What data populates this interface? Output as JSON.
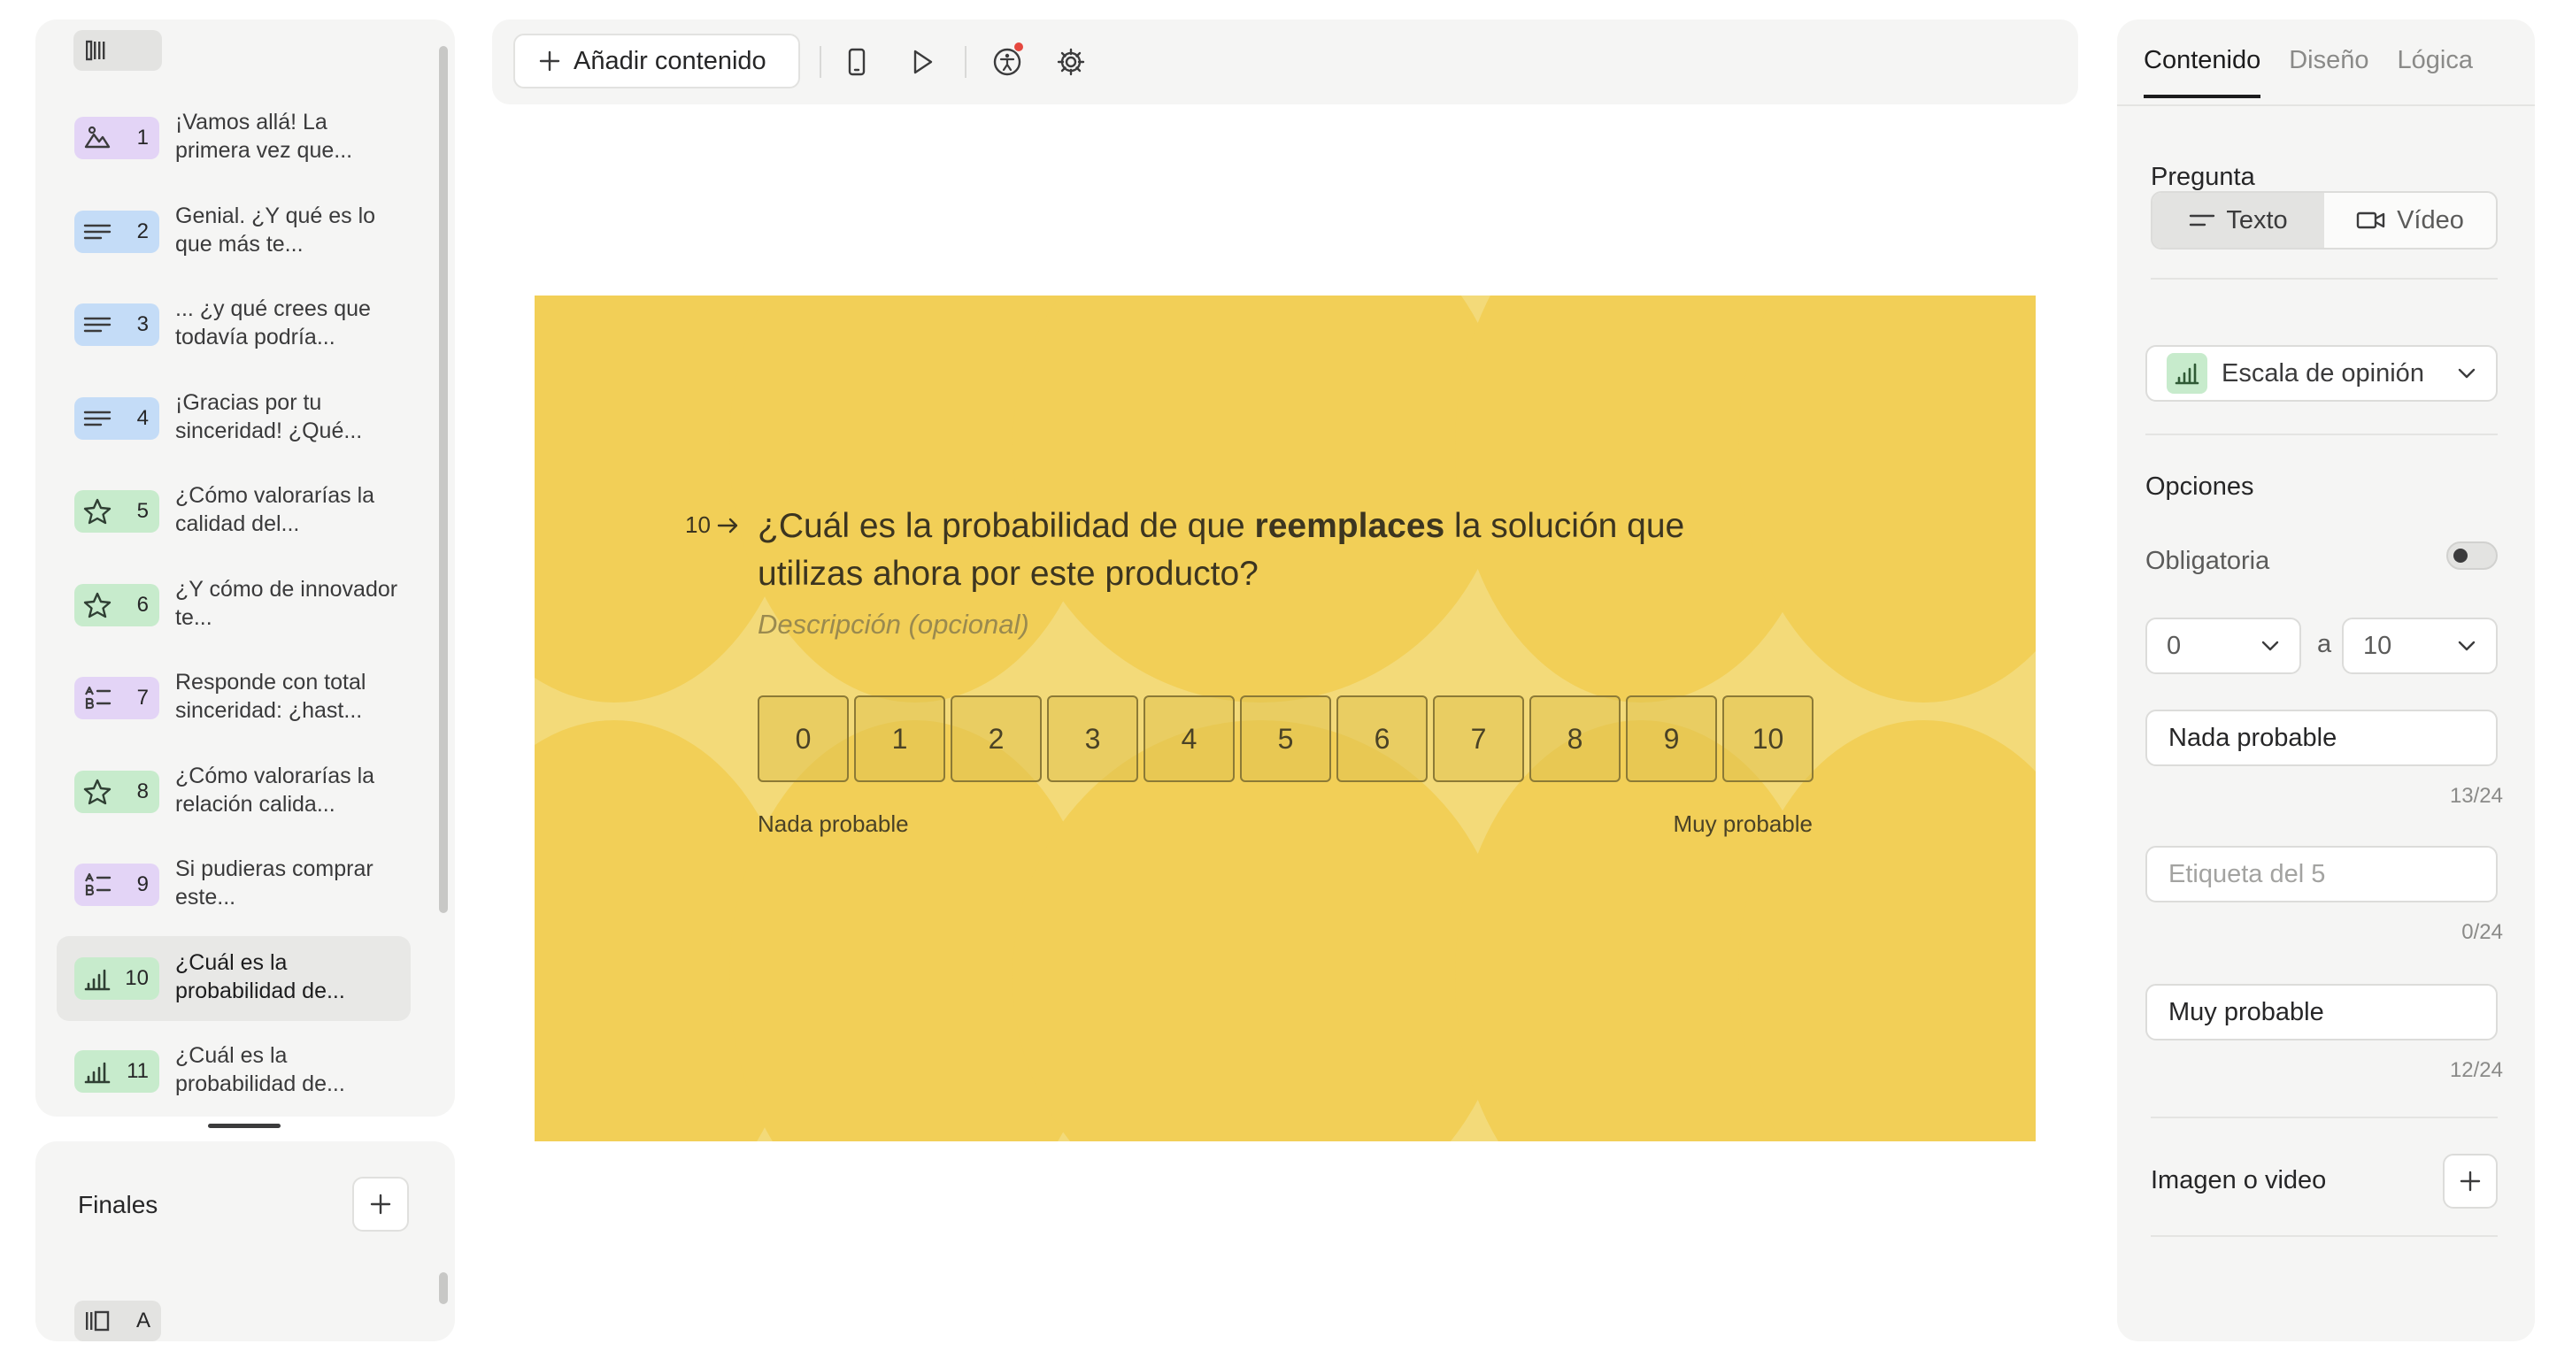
{
  "sidebar": {
    "questions": [
      {
        "number": "1",
        "text": "¡Vamos allá! La primera vez que...",
        "icon": "welcome-image-icon",
        "color": "#e3d4f6"
      },
      {
        "number": "2",
        "text": "Genial. ¿Y qué es lo que más te...",
        "icon": "text-lines-icon",
        "color": "#c4dcf7"
      },
      {
        "number": "3",
        "text": "... ¿y qué crees que todavía podría...",
        "icon": "text-lines-icon",
        "color": "#c4dcf7"
      },
      {
        "number": "4",
        "text": "¡Gracias por tu sinceridad! ¿Qué...",
        "icon": "text-lines-icon",
        "color": "#c4dcf7"
      },
      {
        "number": "5",
        "text": "¿Cómo valorarías la calidad del...",
        "icon": "star-icon",
        "color": "#c7ebcc"
      },
      {
        "number": "6",
        "text": "¿Y cómo de innovador te...",
        "icon": "star-icon",
        "color": "#c7ebcc"
      },
      {
        "number": "7",
        "text": "Responde con total sinceridad: ¿hast...",
        "icon": "ranking-icon",
        "color": "#e3d4f6"
      },
      {
        "number": "8",
        "text": "¿Cómo valorarías la relación calida...",
        "icon": "star-icon",
        "color": "#c7ebcc"
      },
      {
        "number": "9",
        "text": "Si pudieras comprar este...",
        "icon": "ranking-icon",
        "color": "#e3d4f6"
      },
      {
        "number": "10",
        "text": "¿Cuál es la probabilidad de...",
        "icon": "opinion-scale-icon",
        "color": "#c7ebcc"
      },
      {
        "number": "11",
        "text": "¿Cuál es la probabilidad de...",
        "icon": "opinion-scale-icon",
        "color": "#c7ebcc"
      }
    ],
    "active_question": "10",
    "endings_label": "Finales",
    "ending_letter": "A"
  },
  "toolbar": {
    "add_content_label": "Añadir contenido"
  },
  "canvas": {
    "background": "#f3da79",
    "question_number": "10",
    "title_before": "¿Cuál es la probabilidad de que ",
    "title_bold": "reemplaces",
    "title_after": " la solución que utilizas ahora por este producto?",
    "description_placeholder": "Descripción (opcional)",
    "scale_values": [
      "0",
      "1",
      "2",
      "3",
      "4",
      "5",
      "6",
      "7",
      "8",
      "9",
      "10"
    ],
    "label_left": "Nada probable",
    "label_right": "Muy probable"
  },
  "right_panel": {
    "tabs": [
      "Contenido",
      "Diseño",
      "Lógica"
    ],
    "active_tab": "Contenido",
    "question_label": "Pregunta",
    "seg_text": "Texto",
    "seg_video": "Vídeo",
    "question_type": "Escala de opinión",
    "options_label": "Opciones",
    "required_label": "Obligatoria",
    "required_on": false,
    "range_from": "0",
    "range_sep": "a",
    "range_to": "10",
    "label_left_value": "Nada probable",
    "label_left_count": "13/24",
    "label_mid_placeholder": "Etiqueta del 5",
    "label_mid_count": "0/24",
    "label_right_value": "Muy probable",
    "label_right_count": "12/24",
    "media_label": "Imagen o video"
  }
}
